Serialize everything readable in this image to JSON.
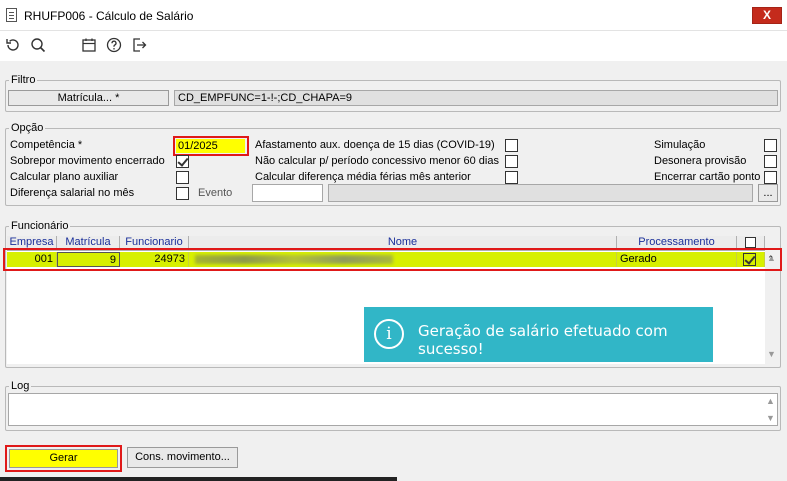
{
  "window": {
    "title": "RHUFP006 - Cálculo de Salário",
    "close_label": "X"
  },
  "toolbar": {
    "icons": [
      "undo-icon",
      "search-icon",
      "calendar-icon",
      "help-icon",
      "exit-icon"
    ]
  },
  "filtro": {
    "label": "Filtro",
    "matricula_button": "Matrícula... *",
    "value": "CD_EMPFUNC=1-!-;CD_CHAPA=9"
  },
  "opcao": {
    "label": "Opção",
    "competencia_label": "Competência *",
    "competencia_value": "01/2025",
    "sobrepor_label": "Sobrepor movimento encerrado",
    "sobrepor_checked": true,
    "plano_auxiliar_label": "Calcular plano auxiliar",
    "plano_auxiliar_checked": false,
    "diferenca_salarial_label": "Diferença salarial no mês",
    "diferenca_salarial_checked": false,
    "evento_label": "Evento",
    "evento_value": "",
    "afastamento_label": "Afastamento aux. doença de 15 dias (COVID-19)",
    "afastamento_checked": false,
    "nao_calcular_label": "Não calcular p/ período concessivo menor 60 dias",
    "nao_calcular_checked": false,
    "diferenca_media_label": "Calcular diferença média férias mês anterior",
    "diferenca_media_checked": false,
    "simulacao_label": "Simulação",
    "simulacao_checked": false,
    "desonera_label": "Desonera provisão",
    "desonera_checked": false,
    "encerrar_label": "Encerrar cartão ponto",
    "encerrar_checked": false,
    "evento_lookup_label": "..."
  },
  "funcionario": {
    "label": "Funcionário",
    "columns": [
      "Empresa",
      "Matrícula",
      "Funcionario",
      "Nome",
      "Processamento"
    ],
    "rows": [
      {
        "empresa": "001",
        "matricula": "9",
        "funcionario": "24973",
        "nome": "",
        "processamento": "Gerado",
        "selected": true
      }
    ],
    "toast_message": "Geração de salário efetuado com sucesso!"
  },
  "log": {
    "label": "Log",
    "value": ""
  },
  "footer": {
    "gerar_button": "Gerar",
    "cons_movimento_button": "Cons. movimento..."
  },
  "colors": {
    "highlight_row": "#d7f000",
    "competencia_bg": "#ffff00",
    "red_outline": "#e01919",
    "toast_bg": "#31b6c7",
    "header_text": "#1a2f9a"
  }
}
